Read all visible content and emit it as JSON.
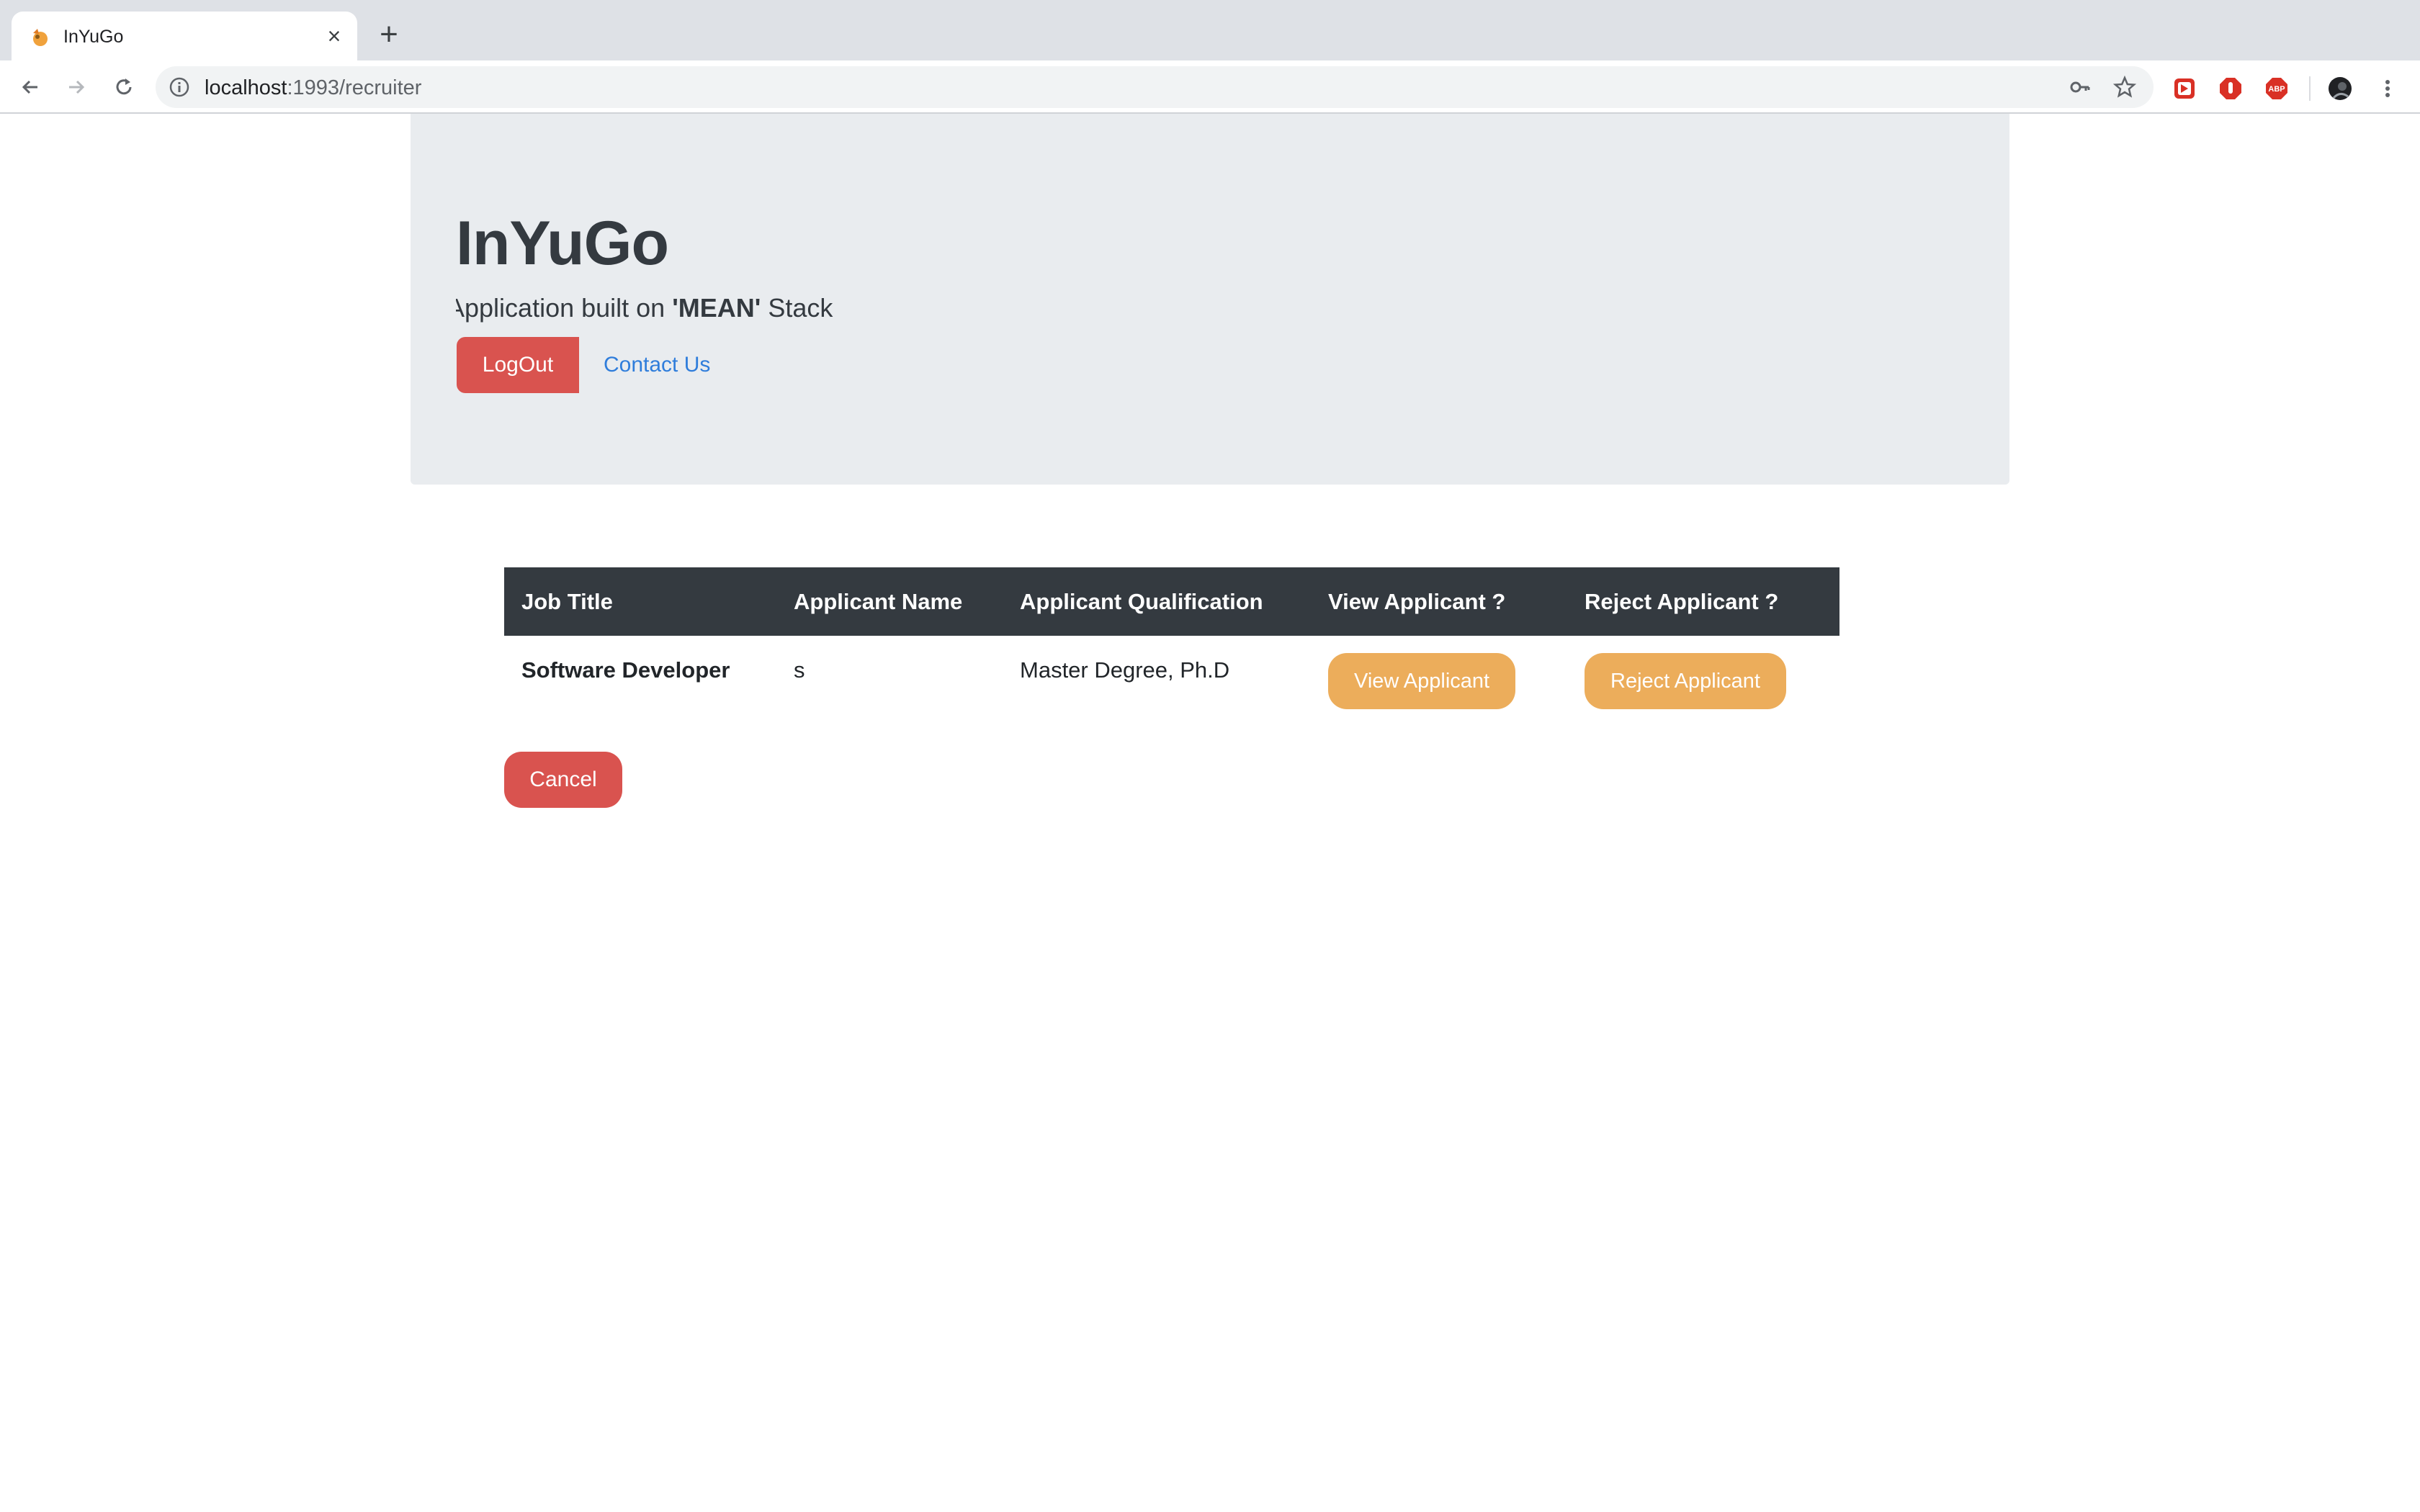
{
  "browser": {
    "tab_title": "InYuGo",
    "new_tab_symbol": "+",
    "close_symbol": "×",
    "url_host": "localhost",
    "url_path": ":1993/recruiter",
    "extension_labels": {
      "abp": "ABP"
    }
  },
  "header": {
    "brand": "InYuGo",
    "lead_prefix": "Application built on ",
    "lead_bold": "'MEAN'",
    "lead_suffix": " Stack",
    "logout_label": "LogOut",
    "contact_label": "Contact Us"
  },
  "table": {
    "columns": [
      "Job Title",
      "Applicant Name",
      "Applicant Qualification",
      "View Applicant ?",
      "Reject Applicant ?"
    ],
    "rows": [
      {
        "job_title": "Software Developer",
        "applicant_name": "s",
        "qualification": "Master Degree, Ph.D",
        "view_label": "View Applicant",
        "reject_label": "Reject Applicant"
      }
    ]
  },
  "actions": {
    "cancel_label": "Cancel"
  },
  "colors": {
    "danger": "#d9534f",
    "warning": "#ecad5b",
    "table_header": "#343a40",
    "jumbotron": "#e9ecef",
    "link": "#2f7ddb"
  }
}
